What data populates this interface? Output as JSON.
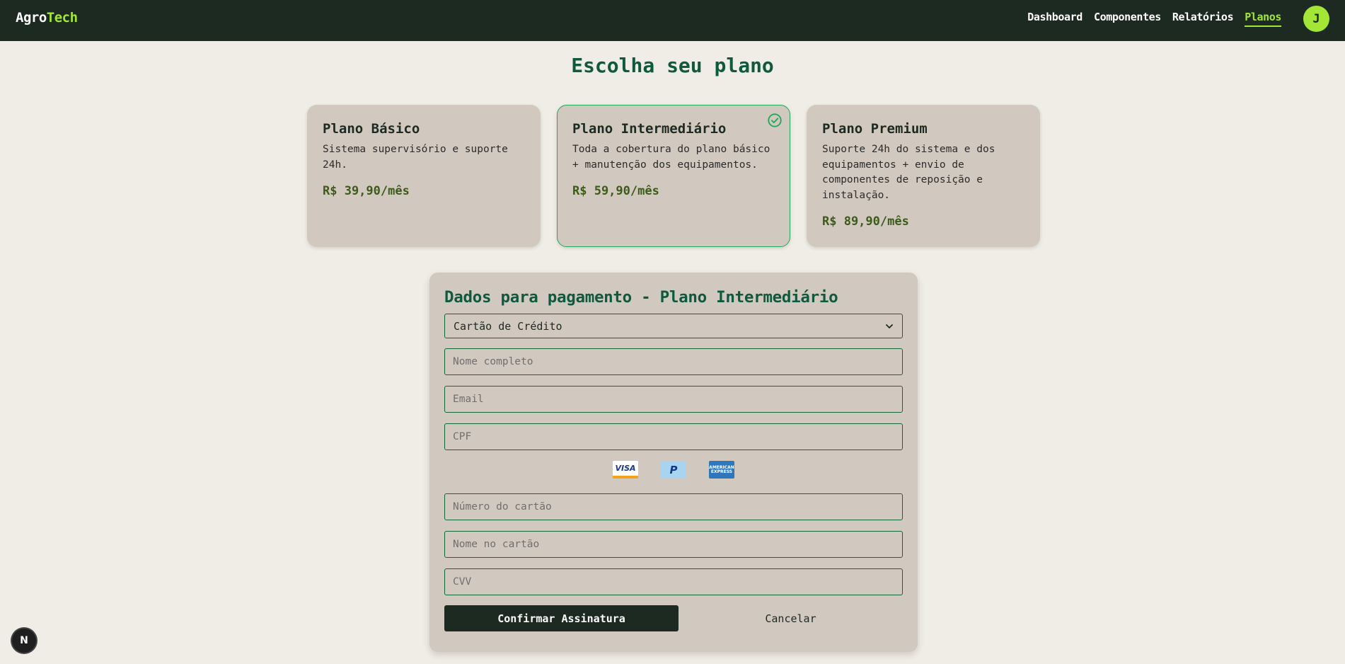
{
  "nav": {
    "logo_main": "Agro",
    "logo_accent": "Tech",
    "links": [
      "Dashboard",
      "Componentes",
      "Relatórios",
      "Planos"
    ],
    "active_link": "Planos",
    "avatar_letter": "J",
    "accent_color": "#a3e635",
    "bg_color": "#1c2a22"
  },
  "page": {
    "title": "Escolha seu plano"
  },
  "plans": [
    {
      "name": "Plano Básico",
      "description": "Sistema supervisório e suporte 24h.",
      "price": "R$ 39,90/mês",
      "selected": false
    },
    {
      "name": "Plano Intermediário",
      "description": "Toda a cobertura do plano básico + manutenção dos equipamentos.",
      "price": "R$ 59,90/mês",
      "selected": true,
      "icon": "check-circle-icon"
    },
    {
      "name": "Plano Premium",
      "description": "Suporte 24h do sistema e dos equipamentos + envio de componentes de reposição e instalação.",
      "price": "R$ 89,90/mês",
      "selected": false
    }
  ],
  "payment": {
    "title": "Dados para pagamento - Plano Intermediário",
    "method_selected": "Cartão de Crédito",
    "fields": {
      "full_name": "Nome completo",
      "email": "Email",
      "cpf": "CPF",
      "card_number": "Número do cartão",
      "card_name": "Nome no cartão",
      "cvv": "CVV"
    },
    "card_brands": {
      "visa": "VISA",
      "paypal": "P",
      "amex": "AMERICAN EXPRESS"
    },
    "confirm_label": "Confirmar Assinatura",
    "cancel_label": "Cancelar"
  },
  "dev_badge": "N"
}
